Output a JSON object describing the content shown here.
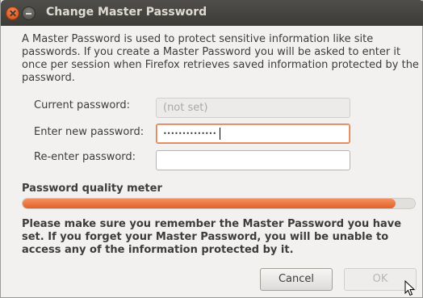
{
  "window": {
    "title": "Change Master Password"
  },
  "intro_text": "A Master Password is used to protect sensitive information like site passwords. If you create a Master Password you will be asked to enter it once per session when Firefox retrieves saved information protected by the password.",
  "form": {
    "current_password": {
      "label": "Current password:",
      "value": "(not set)"
    },
    "new_password": {
      "label": "Enter new password:",
      "value": "••••••••••••••"
    },
    "reenter_password": {
      "label": "Re-enter password:",
      "value": ""
    }
  },
  "quality_meter": {
    "label": "Password quality meter",
    "level_fraction": 0.95,
    "color": "#e96a32"
  },
  "warning_text": "Please make sure you remember the Master Password you have set. If you forget your Master Password, you will be unable to access any of the information protected by it.",
  "buttons": {
    "cancel_label": "Cancel",
    "ok_label": "OK"
  },
  "icons": {
    "close": "close-icon",
    "minimize": "minimize-icon",
    "cursor": "pointer-cursor-icon"
  }
}
